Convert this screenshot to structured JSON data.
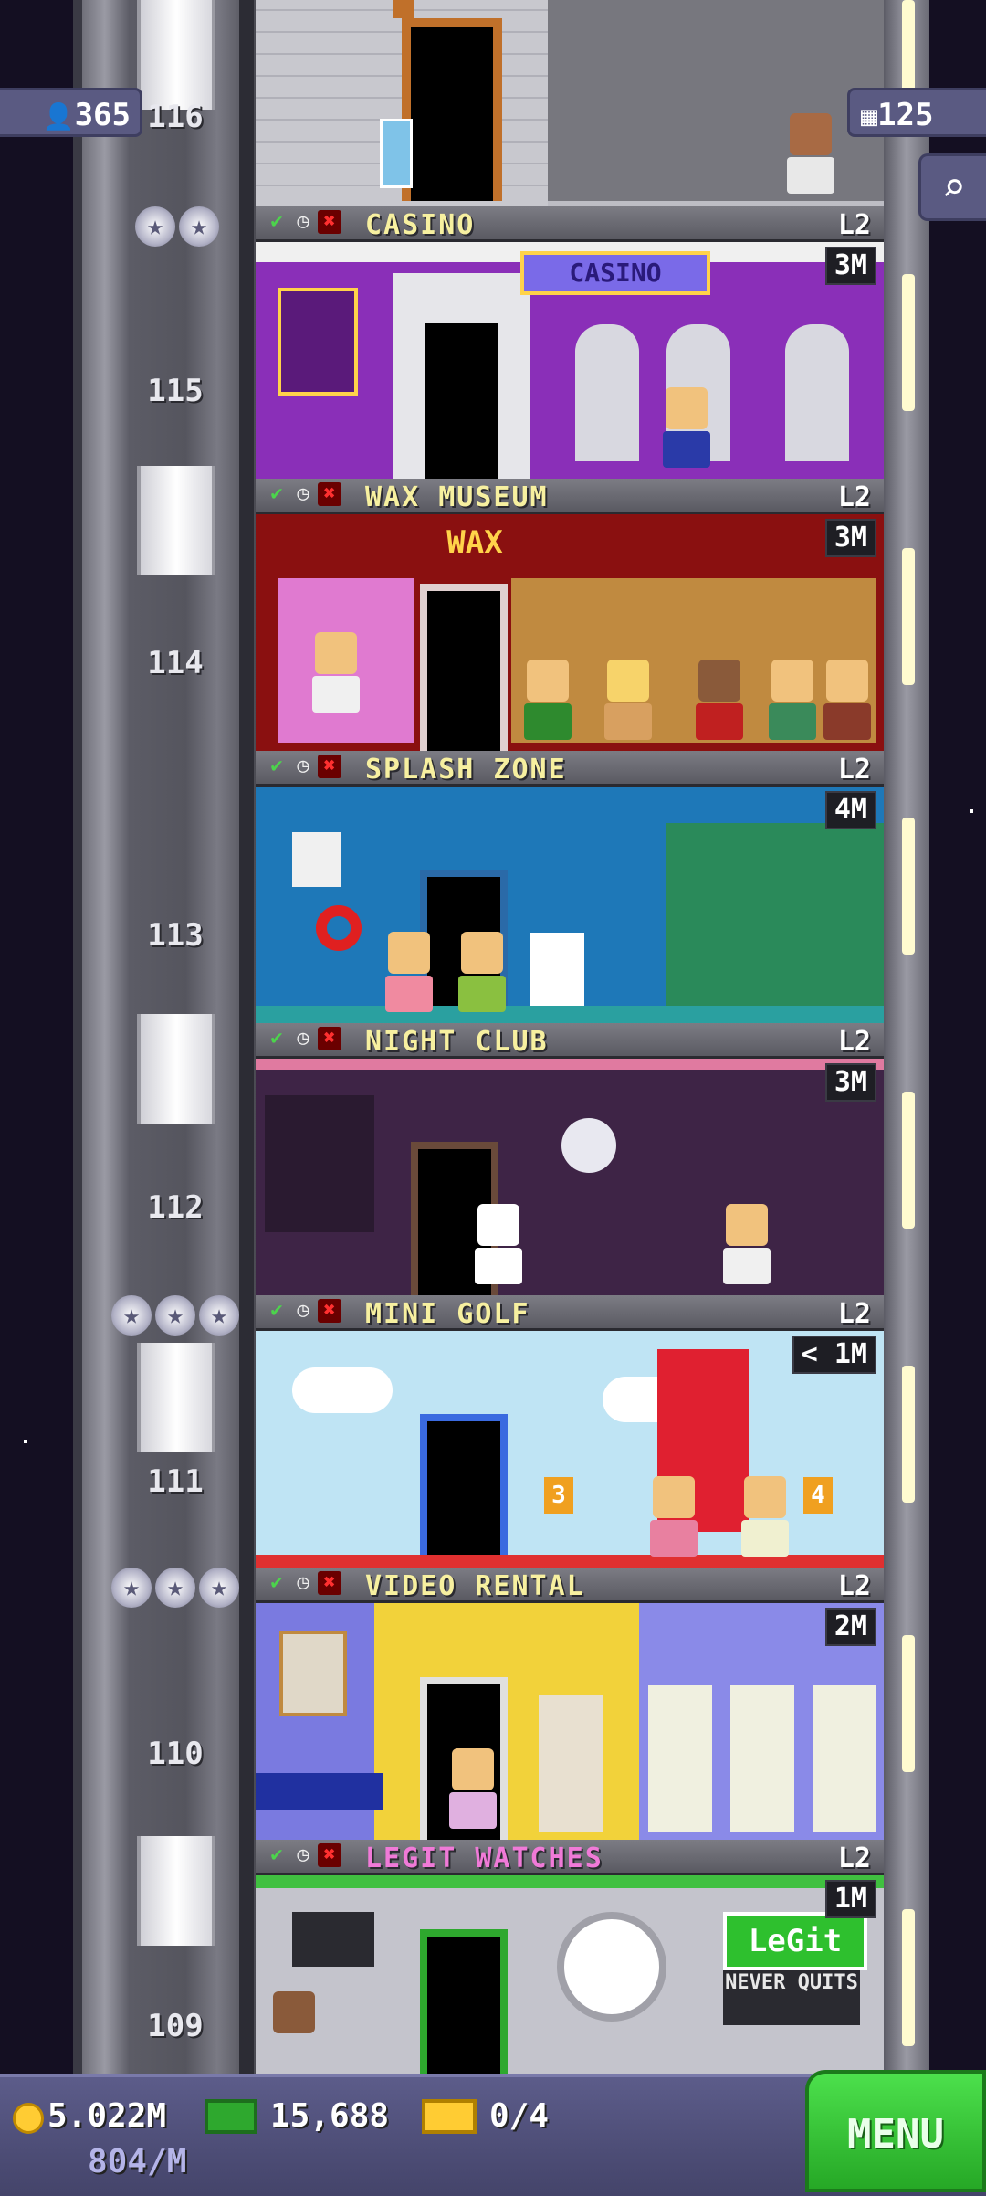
{
  "hud": {
    "population": "365",
    "floor_count": "125",
    "coins": "5.022M",
    "coins_rate": "804/M",
    "bux": "15,688",
    "tickets": "0/4",
    "menu_label": "MENU"
  },
  "floors": [
    {
      "number": "116",
      "name": "",
      "level": "",
      "time": "",
      "stars": 0
    },
    {
      "number": "115",
      "name": "CASINO",
      "level": "L2",
      "time": "3M",
      "stars": 2,
      "sign": "CASINO"
    },
    {
      "number": "114",
      "name": "WAX MUSEUM",
      "level": "L2",
      "time": "3M",
      "stars": 0,
      "sign": "WAX"
    },
    {
      "number": "113",
      "name": "SPLASH ZONE",
      "level": "L2",
      "time": "4M",
      "stars": 0
    },
    {
      "number": "112",
      "name": "NIGHT CLUB",
      "level": "L2",
      "time": "3M",
      "stars": 0
    },
    {
      "number": "111",
      "name": "MINI GOLF",
      "level": "L2",
      "time": "< 1M",
      "stars": 3,
      "holes": [
        "3",
        "4"
      ]
    },
    {
      "number": "110",
      "name": "VIDEO RENTAL",
      "level": "L2",
      "time": "2M",
      "stars": 3
    },
    {
      "number": "109",
      "name": "LEGIT WATCHES",
      "level": "L2",
      "time": "1M",
      "stars": 0,
      "sign": "LeGit",
      "sign_sub": "NEVER QUITS"
    }
  ],
  "colors": {
    "casino": "#8a2fb8",
    "wax": "#8a1010",
    "splash": "#1e78b8",
    "night": "#3e2446",
    "golf": "#bfe4f4",
    "video": "#f2d23a",
    "legit": "#c4c4cc",
    "gym": "#6a6a6a"
  }
}
